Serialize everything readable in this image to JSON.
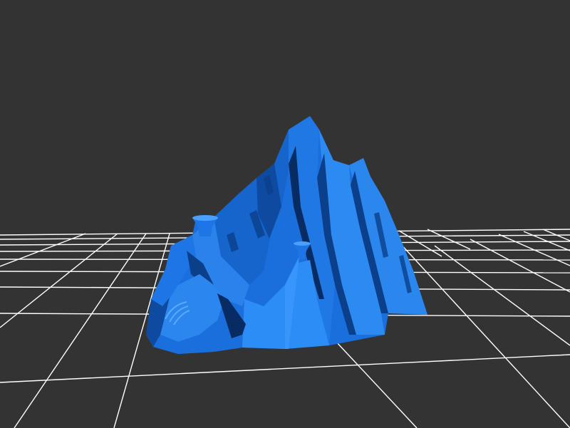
{
  "viewer": {
    "background_color": "#333333",
    "grid_color": "#ffffff",
    "model_color": "#1a6fdc",
    "model_highlight_color": "#2d8af0",
    "model_shadow_color": "#0b3f8a",
    "model_dark_color": "#072c63"
  }
}
